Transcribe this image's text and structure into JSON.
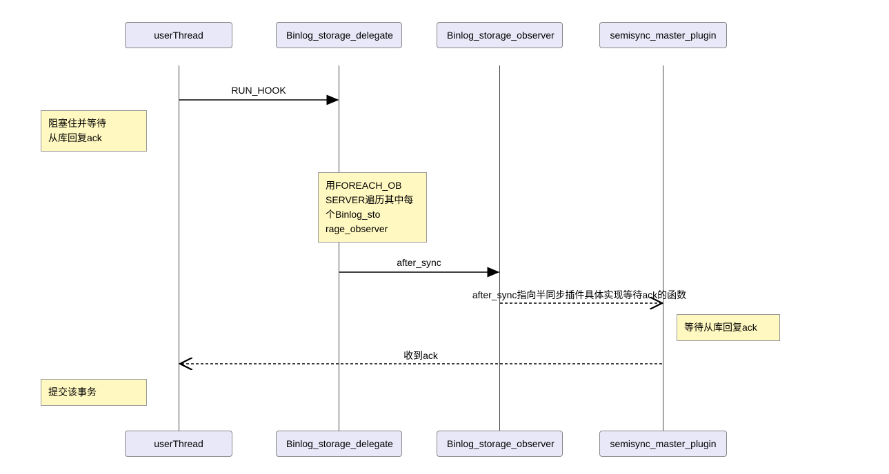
{
  "participants": {
    "p1": "userThread",
    "p2": "Binlog_storage_delegate",
    "p3": "Binlog_storage_observer",
    "p4": "semisync_master_plugin"
  },
  "messages": {
    "m1": "RUN_HOOK",
    "m2": "after_sync",
    "m3": "after_sync指向半同步插件具体实现等待ack的函数",
    "m4": "收到ack"
  },
  "notes": {
    "n1_l1": "阻塞住并等待",
    "n1_l2": "从库回复ack",
    "n2_l1": "用FOREACH_OB",
    "n2_l2": "SERVER遍历其中每",
    "n2_l3": "个Binlog_sto",
    "n2_l4": "rage_observer",
    "n3": "等待从库回复ack",
    "n4": "提交该事务"
  }
}
